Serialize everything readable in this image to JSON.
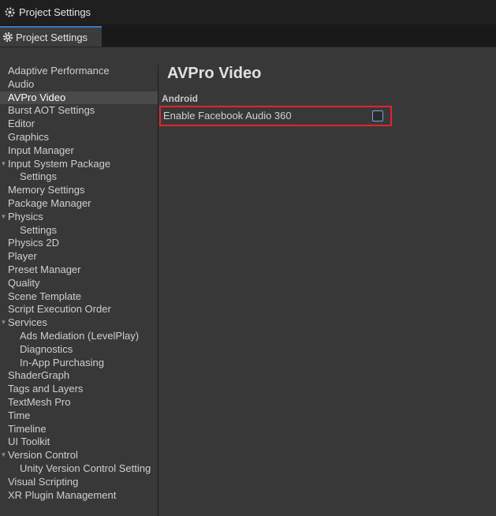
{
  "window": {
    "title": "Project Settings",
    "icon": "unity-gear-icon"
  },
  "tab": {
    "label": "Project Settings",
    "icon": "gear-icon"
  },
  "sidebar": {
    "items": [
      {
        "label": "Adaptive Performance",
        "level": 0
      },
      {
        "label": "Audio",
        "level": 0
      },
      {
        "label": "AVPro Video",
        "level": 0,
        "selected": true
      },
      {
        "label": "Burst AOT Settings",
        "level": 0
      },
      {
        "label": "Editor",
        "level": 0
      },
      {
        "label": "Graphics",
        "level": 0
      },
      {
        "label": "Input Manager",
        "level": 0
      },
      {
        "label": "Input System Package",
        "level": 0,
        "expanded": true
      },
      {
        "label": "Settings",
        "level": 1
      },
      {
        "label": "Memory Settings",
        "level": 0
      },
      {
        "label": "Package Manager",
        "level": 0
      },
      {
        "label": "Physics",
        "level": 0,
        "expanded": true
      },
      {
        "label": "Settings",
        "level": 1
      },
      {
        "label": "Physics 2D",
        "level": 0
      },
      {
        "label": "Player",
        "level": 0
      },
      {
        "label": "Preset Manager",
        "level": 0
      },
      {
        "label": "Quality",
        "level": 0
      },
      {
        "label": "Scene Template",
        "level": 0
      },
      {
        "label": "Script Execution Order",
        "level": 0
      },
      {
        "label": "Services",
        "level": 0,
        "expanded": true
      },
      {
        "label": "Ads Mediation (LevelPlay)",
        "level": 1
      },
      {
        "label": "Diagnostics",
        "level": 1
      },
      {
        "label": "In-App Purchasing",
        "level": 1
      },
      {
        "label": "ShaderGraph",
        "level": 0
      },
      {
        "label": "Tags and Layers",
        "level": 0
      },
      {
        "label": "TextMesh Pro",
        "level": 0
      },
      {
        "label": "Time",
        "level": 0
      },
      {
        "label": "Timeline",
        "level": 0
      },
      {
        "label": "UI Toolkit",
        "level": 0
      },
      {
        "label": "Version Control",
        "level": 0,
        "expanded": true
      },
      {
        "label": "Unity Version Control Setting",
        "level": 1
      },
      {
        "label": "Visual Scripting",
        "level": 0
      },
      {
        "label": "XR Plugin Management",
        "level": 0
      }
    ]
  },
  "main": {
    "title": "AVPro Video",
    "section": "Android",
    "setting": {
      "label": "Enable Facebook Audio 360",
      "checked": false
    }
  },
  "colors": {
    "highlight_border": "#e3242b",
    "tab_accent": "#3a79bb",
    "background": "#383838"
  }
}
